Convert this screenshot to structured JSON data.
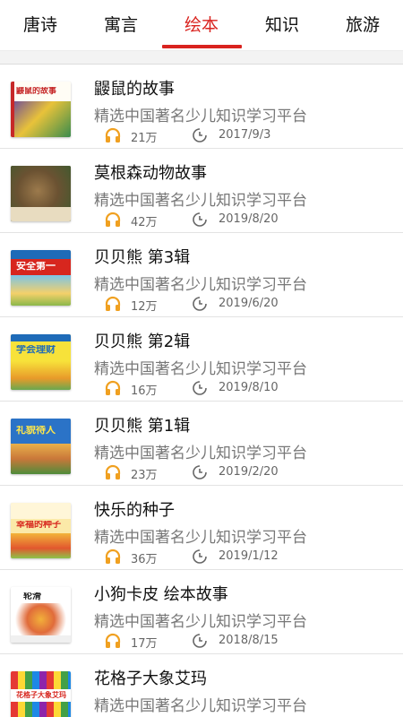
{
  "tabs": [
    {
      "label": "唐诗"
    },
    {
      "label": "寓言"
    },
    {
      "label": "绘本",
      "active": true
    },
    {
      "label": "知识"
    },
    {
      "label": "旅游"
    }
  ],
  "accent_color": "#d9231f",
  "items": [
    {
      "title": "鼹鼠的故事",
      "subtitle": "精选中国著名少儿知识学习平台",
      "plays": "21万",
      "date": "2017/9/3",
      "cover_text": "鼹鼠的故事"
    },
    {
      "title": "莫根森动物故事",
      "subtitle": "精选中国著名少儿知识学习平台",
      "plays": "42万",
      "date": "2019/8/20",
      "cover_text": ""
    },
    {
      "title": "贝贝熊 第3辑",
      "subtitle": "精选中国著名少儿知识学习平台",
      "plays": "12万",
      "date": "2019/6/20",
      "cover_text": "安全第一"
    },
    {
      "title": "贝贝熊 第2辑",
      "subtitle": "精选中国著名少儿知识学习平台",
      "plays": "16万",
      "date": "2019/8/10",
      "cover_text": "学会理财"
    },
    {
      "title": "贝贝熊 第1辑",
      "subtitle": "精选中国著名少儿知识学习平台",
      "plays": "23万",
      "date": "2019/2/20",
      "cover_text": "礼貌待人"
    },
    {
      "title": "快乐的种子",
      "subtitle": "精选中国著名少儿知识学习平台",
      "plays": "36万",
      "date": "2019/1/12",
      "cover_text": "幸福的种子"
    },
    {
      "title": "小狗卡皮 绘本故事",
      "subtitle": "精选中国著名少儿知识学习平台",
      "plays": "17万",
      "date": "2018/8/15",
      "cover_text": "轮滑"
    },
    {
      "title": "花格子大象艾玛",
      "subtitle": "精选中国著名少儿知识学习平台",
      "plays": "",
      "date": "",
      "cover_text": "花格子大象艾玛"
    }
  ],
  "icons": {
    "plays": "headphone-icon",
    "date": "clock-icon"
  }
}
